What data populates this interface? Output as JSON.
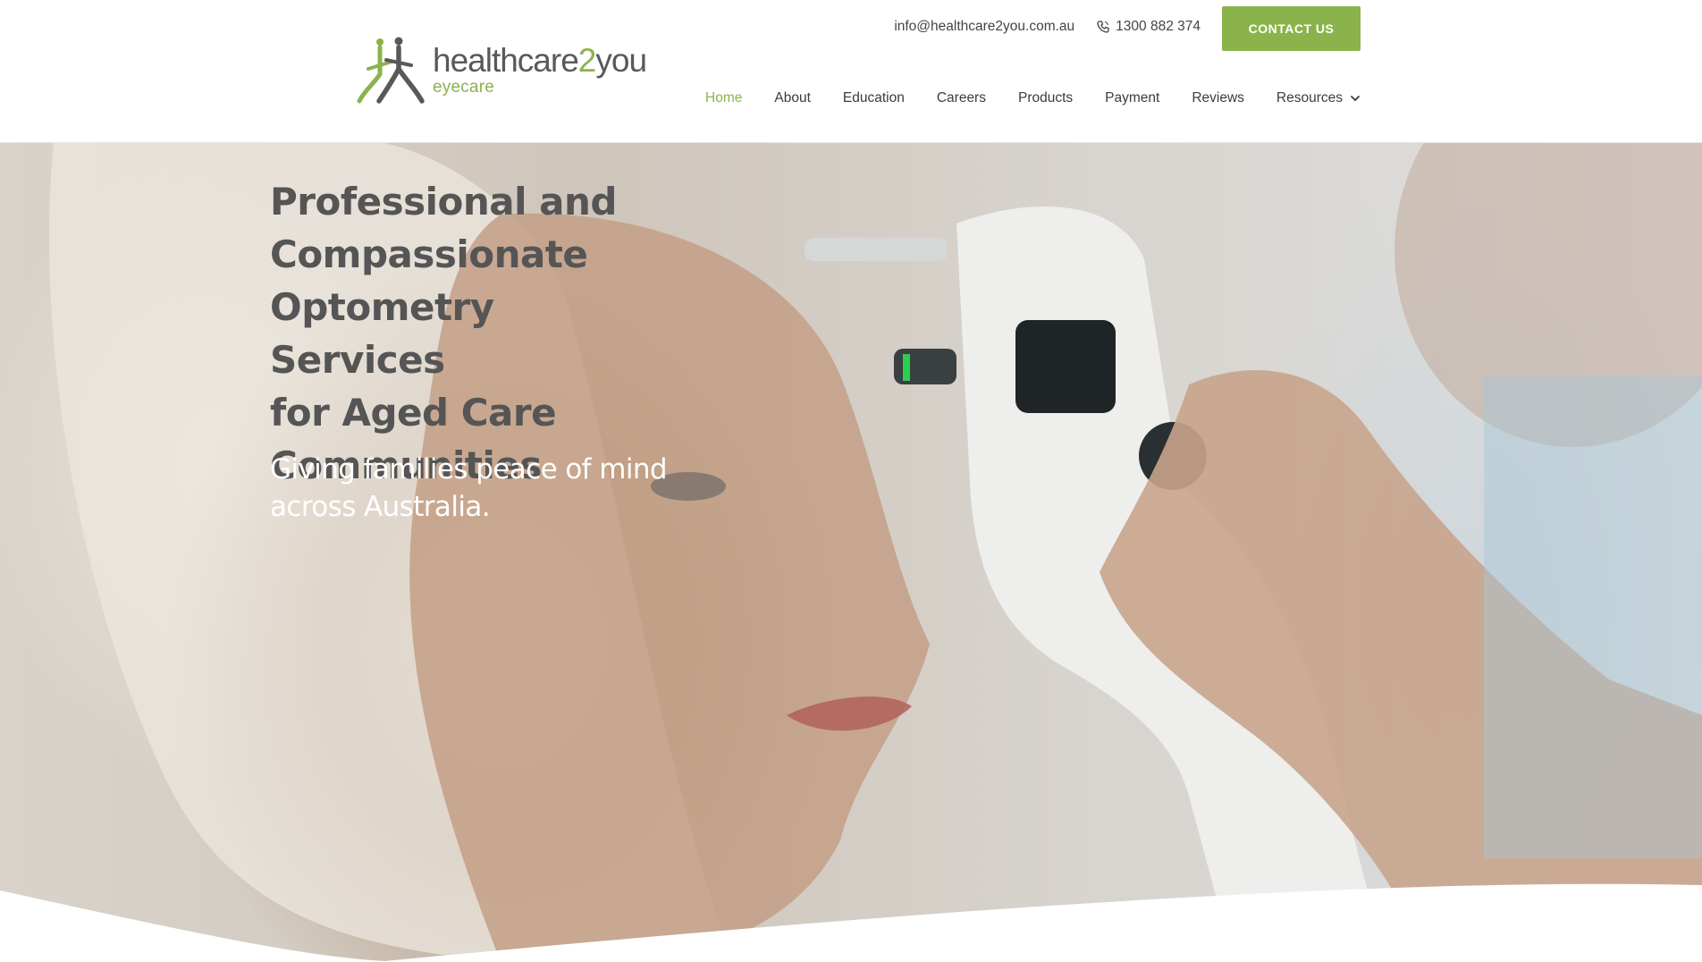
{
  "brand": {
    "name_part1": "healthcare",
    "name_part2": "2",
    "name_part3": "you",
    "tagline": "eyecare",
    "colors": {
      "accent": "#8ab34c",
      "text": "#555555"
    }
  },
  "topbar": {
    "email": "info@healthcare2you.com.au",
    "phone": "1300 882 374",
    "phone_icon": "phone-icon",
    "contact_label": "CONTACT US"
  },
  "nav": {
    "items": [
      {
        "label": "Home",
        "active": true
      },
      {
        "label": "About"
      },
      {
        "label": "Education"
      },
      {
        "label": "Careers"
      },
      {
        "label": "Products"
      },
      {
        "label": "Payment"
      },
      {
        "label": "Reviews"
      },
      {
        "label": "Resources",
        "icon": "chevron-down-icon"
      }
    ]
  },
  "hero": {
    "title_lines": [
      "Professional and",
      "Compassionate",
      "Optometry Services",
      "for Aged Care",
      "Communities"
    ],
    "subtitle_lines": [
      "Giving families peace of mind",
      "across Australia."
    ]
  }
}
